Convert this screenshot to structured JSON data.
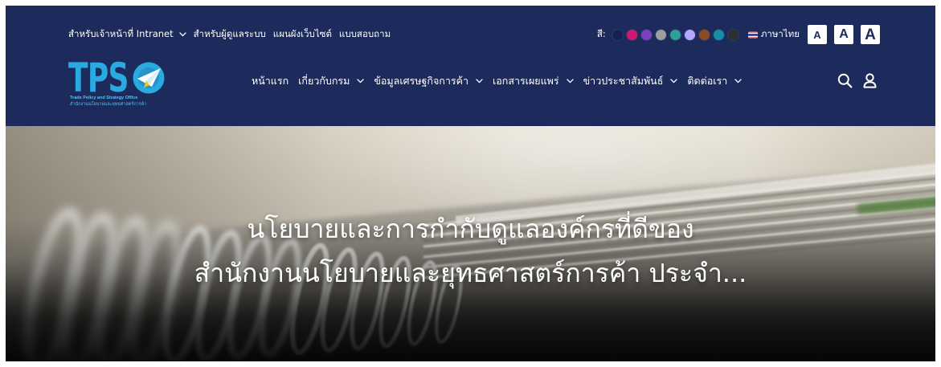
{
  "colors": {
    "header_bg": "#1c2a5c",
    "logo_blue": "#29abe2",
    "nav_text": "#ffffff",
    "font_button_bg": "#ffffff",
    "font_button_text": "#1c2a5c",
    "hero_title": "#ffffff"
  },
  "utility_bar": {
    "links": [
      {
        "label": "สำหรับเจ้าหน้าที่ Intranet"
      },
      {
        "label": "สำหรับผู้ดูแลระบบ"
      },
      {
        "label": "แผนผังเว็บไซต์"
      },
      {
        "label": "แบบสอบถาม"
      }
    ],
    "color_label": "สี:",
    "color_swatches": [
      "#17214f",
      "#d2176f",
      "#7f3fbf",
      "#9e9e9e",
      "#2aa198",
      "#b4a6ff",
      "#8d4b22",
      "#148fa8",
      "#2e2e2e"
    ],
    "language": {
      "label": "ภาษาไทย",
      "flag_icon": "thai-flag-icon"
    },
    "font_size_buttons": [
      "A",
      "A",
      "A"
    ]
  },
  "logo": {
    "letters": "TPS",
    "symbol_icon": "paper-plane-o-icon",
    "tagline_en": "Trade Policy and Strategy Office",
    "tagline_th": "สำนักงานนโยบายและยุทธศาสตร์การค้า"
  },
  "nav": {
    "items": [
      {
        "label": "หน้าแรก"
      },
      {
        "label": "เกี่ยวกับกรม"
      },
      {
        "label": "ข้อมูลเศรษฐกิจการค้า"
      },
      {
        "label": "เอกสารเผยแพร่"
      },
      {
        "label": "ข่าวประชาสัมพันธ์"
      },
      {
        "label": "ติดต่อเรา"
      }
    ],
    "dropdown_icon": "chevron-down-icon",
    "icons": {
      "search": "search-icon",
      "account": "user-icon"
    }
  },
  "hero": {
    "title_lines": [
      "นโยบายและการกำกับดูแลองค์กรที่ดีของ",
      "สำนักงานนโยบายและยุทธศาสตร์การค้า ประจำ..."
    ]
  }
}
